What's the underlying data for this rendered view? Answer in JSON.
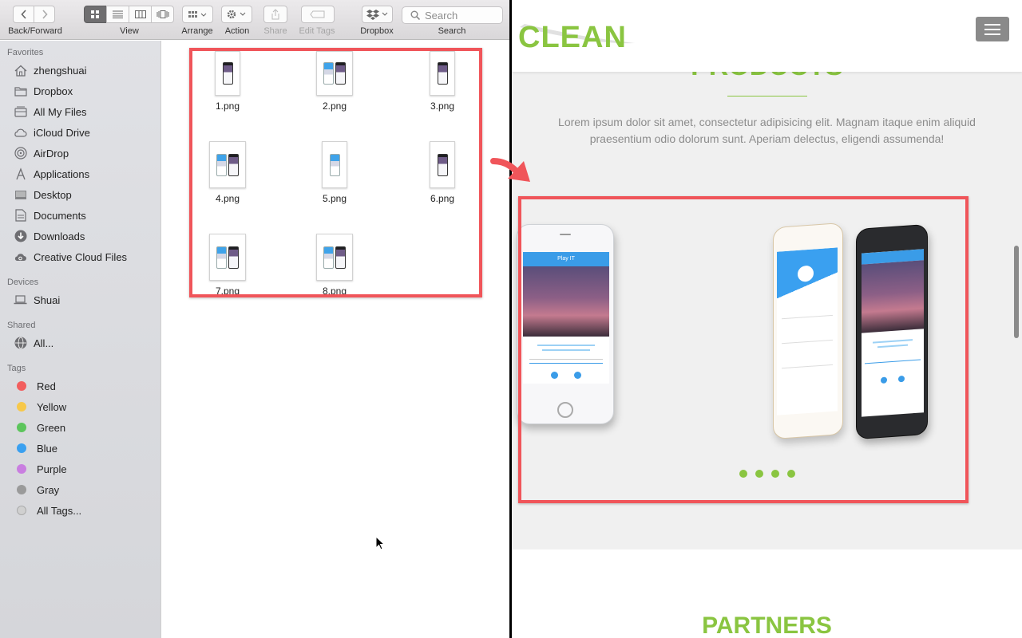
{
  "finder": {
    "toolbar": {
      "back_forward": "Back/Forward",
      "view": "View",
      "arrange": "Arrange",
      "action": "Action",
      "share": "Share",
      "edit_tags": "Edit Tags",
      "dropbox": "Dropbox",
      "search_label": "Search",
      "search_placeholder": "Search"
    },
    "sidebar": {
      "favorites_header": "Favorites",
      "favorites": [
        {
          "label": "zhengshuai",
          "icon": "home-icon"
        },
        {
          "label": "Dropbox",
          "icon": "folder-icon"
        },
        {
          "label": "All My Files",
          "icon": "all-files-icon"
        },
        {
          "label": "iCloud Drive",
          "icon": "cloud-icon"
        },
        {
          "label": "AirDrop",
          "icon": "airdrop-icon"
        },
        {
          "label": "Applications",
          "icon": "applications-icon"
        },
        {
          "label": "Desktop",
          "icon": "desktop-icon"
        },
        {
          "label": "Documents",
          "icon": "documents-icon"
        },
        {
          "label": "Downloads",
          "icon": "downloads-icon"
        },
        {
          "label": "Creative Cloud Files",
          "icon": "creative-cloud-icon"
        }
      ],
      "devices_header": "Devices",
      "devices": [
        {
          "label": "Shuai",
          "icon": "laptop-icon"
        }
      ],
      "shared_header": "Shared",
      "shared": [
        {
          "label": "All...",
          "icon": "network-icon"
        }
      ],
      "tags_header": "Tags",
      "tags": [
        {
          "label": "Red",
          "color": "#f25e5e"
        },
        {
          "label": "Yellow",
          "color": "#f7c84a"
        },
        {
          "label": "Green",
          "color": "#5cc55c"
        },
        {
          "label": "Blue",
          "color": "#3aa0f0"
        },
        {
          "label": "Purple",
          "color": "#c97ee0"
        },
        {
          "label": "Gray",
          "color": "#9a9a9a"
        },
        {
          "label": "All Tags...",
          "color": "#c8c8c8"
        }
      ]
    },
    "files": [
      "1.png",
      "2.png",
      "3.png",
      "4.png",
      "5.png",
      "6.png",
      "7.png",
      "8.png"
    ]
  },
  "website": {
    "logo": "CLEAN",
    "section_heading_partial": "PRODUCTS",
    "lorem": "Lorem ipsum dolor sit amet, consectetur adipisicing elit. Magnam itaque enim aliquid praesentium odio dolorum sunt. Aperiam delectus, eligendi assumenda!",
    "phone_screen_title": "Play IT",
    "partners_heading": "PARTNERS",
    "carousel_dots": 4
  },
  "colors": {
    "brand_green": "#8ac541",
    "annotation_red": "#f0555a"
  }
}
